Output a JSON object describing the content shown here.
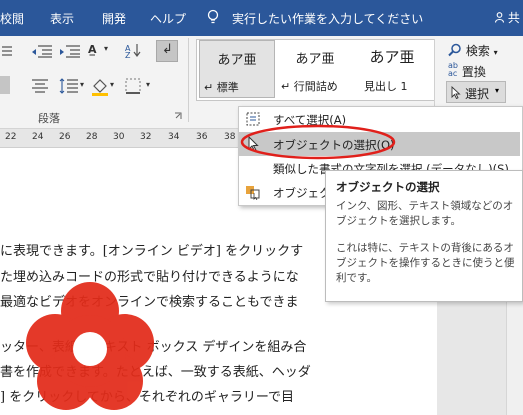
{
  "tabs": [
    {
      "label": "校閲"
    },
    {
      "label": "表示"
    },
    {
      "label": "開発"
    },
    {
      "label": "ヘルプ"
    }
  ],
  "tell_me": {
    "text": "実行したい作業を入力してください",
    "icon": "lightbulb-icon"
  },
  "share": {
    "label": "共"
  },
  "ribbon": {
    "paragraph_group_label": "段落",
    "styles": [
      {
        "preview": "あア亜",
        "name": "↵ 標準"
      },
      {
        "preview": "あア亜",
        "name": "↵ 行間詰め"
      },
      {
        "preview": "あア亜",
        "name": "見出し 1"
      }
    ],
    "editing": {
      "search_label": "検索",
      "replace_label": "置換",
      "select_label": "選択"
    }
  },
  "ruler": {
    "ticks": [
      "22",
      "24",
      "26",
      "28",
      "30",
      "32",
      "34",
      "36",
      "38"
    ]
  },
  "document": {
    "lines": [
      "に表現できます。[オンライン ビデオ] をクリックす",
      "た埋め込みコードの形式で貼り付けできるようにな",
      "最適なビデオをオンラインで検索することもできま",
      "ッター、表紙、テキスト ボックス デザインを組み合",
      "書を作成できます。たとえば、一致する表紙、ヘッダ",
      "] をクリックしてから、それぞれのギャラリーで目"
    ]
  },
  "select_menu": {
    "items": [
      {
        "label": "すべて選択(A)",
        "icon": "select-all-icon"
      },
      {
        "label": "オブジェクトの選択(O)",
        "icon": "cursor-arrow-icon"
      },
      {
        "label": "類似した書式の文字列を選択 (データなし)(S)",
        "icon": ""
      },
      {
        "label": "オブジェクトの",
        "icon": "selection-pane-icon"
      }
    ]
  },
  "tooltip": {
    "title": "オブジェクトの選択",
    "body1": "インク、図形、テキスト領域などのオブジェクトを選択します。",
    "body2": "これは特に、テキストの背後にあるオブジェクトを操作するときに使うと便利です。"
  },
  "colors": {
    "tab_bar": "#2b579a",
    "annotation_red": "#e0201b",
    "flower_red": "#e32b19"
  }
}
